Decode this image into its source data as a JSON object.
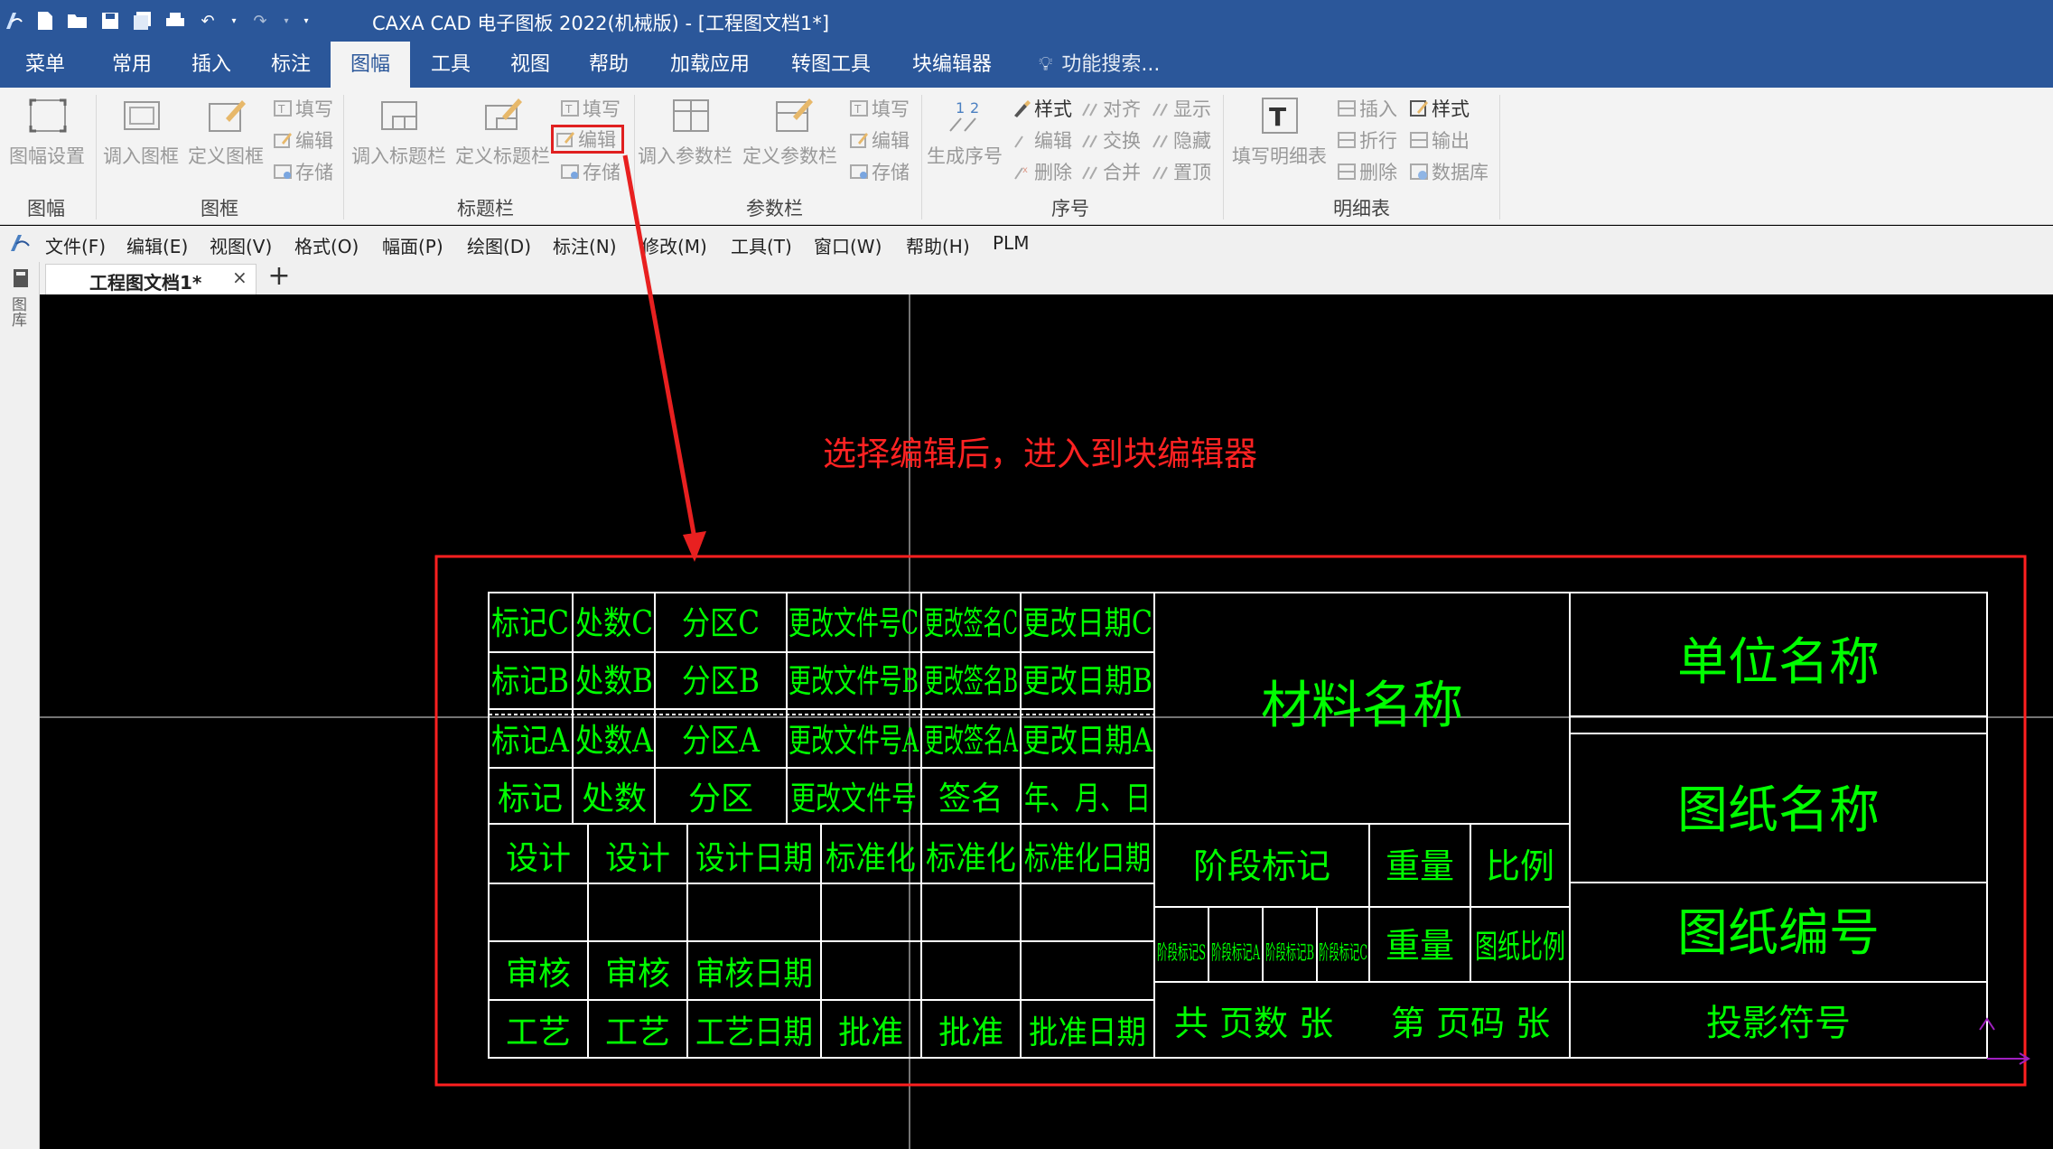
{
  "titlebar": {
    "title": "CAXA CAD 电子图板 2022(机械版) - [工程图文档1*]"
  },
  "ribbon_tabs": [
    "菜单",
    "常用",
    "插入",
    "标注",
    "图幅",
    "工具",
    "视图",
    "帮助",
    "加载应用",
    "转图工具",
    "块编辑器"
  ],
  "ribbon_active_tab": "图幅",
  "search_placeholder": "功能搜索...",
  "ribbon": {
    "groups": {
      "sheet": "图幅",
      "frame": "图框",
      "titleblock": "标题栏",
      "param": "参数栏",
      "seq": "序号",
      "bom": "明细表"
    },
    "sheet_setup": "图幅设置",
    "frame_load": "调入图框",
    "frame_define": "定义图框",
    "frame_fill": "填写",
    "frame_edit": "编辑",
    "frame_save": "存储",
    "tb_load": "调入标题栏",
    "tb_define": "定义标题栏",
    "tb_fill": "填写",
    "tb_edit": "编辑",
    "tb_save": "存储",
    "pm_load": "调入参数栏",
    "pm_define": "定义参数栏",
    "pm_fill": "填写",
    "pm_edit": "编辑",
    "pm_save": "存储",
    "seq_gen": "生成序号",
    "seq_style": "样式",
    "seq_align": "对齐",
    "seq_show": "显示",
    "seq_edit": "编辑",
    "seq_swap": "交换",
    "seq_hide": "隐藏",
    "seq_delete": "删除",
    "seq_merge": "合并",
    "seq_top": "置顶",
    "bom_fill": "填写明细表",
    "bom_insert": "插入",
    "bom_style": "样式",
    "bom_fold": "折行",
    "bom_output": "输出",
    "bom_delete": "删除",
    "bom_db": "数据库"
  },
  "menubar": [
    "文件(F)",
    "编辑(E)",
    "视图(V)",
    "格式(O)",
    "幅面(P)",
    "绘图(D)",
    "标注(N)",
    "修改(M)",
    "工具(T)",
    "窗口(W)",
    "帮助(H)",
    "PLM"
  ],
  "doc_tab": {
    "label": "工程图文档1*",
    "close": "×",
    "add": "+"
  },
  "side_panel_label": "图库",
  "annotation": "选择编辑后，进入到块编辑器",
  "titleblock": {
    "rows_change": [
      [
        "标记C",
        "处数C",
        "分区C",
        "更改文件号C",
        "更改签名C",
        "更改日期C"
      ],
      [
        "标记B",
        "处数B",
        "分区B",
        "更改文件号B",
        "更改签名B",
        "更改日期B"
      ],
      [
        "标记A",
        "处数A",
        "分区A",
        "更改文件号A",
        "更改签名A",
        "更改日期A"
      ],
      [
        "标记",
        "处数",
        "分区",
        "更改文件号",
        "签名",
        "年、月、日"
      ]
    ],
    "row_design": [
      "设计",
      "设计",
      "设计日期",
      "标准化",
      "标准化",
      "标准化日期"
    ],
    "row_review": [
      "审核",
      "审核",
      "审核日期"
    ],
    "row_process": [
      "工艺",
      "工艺",
      "工艺日期",
      "批准",
      "批准",
      "批准日期"
    ],
    "material": "材料名称",
    "stage_mark": "阶段标记",
    "weight": "重量",
    "scale": "比例",
    "stage_vals": [
      "阶段标记S",
      "阶段标记A",
      "阶段标记B",
      "阶段标记C"
    ],
    "weight_val": "重量",
    "scale_val": "图纸比例",
    "pages": "共 页数 张",
    "page_no": "第 页码 张",
    "unit_name": "单位名称",
    "drawing_name": "图纸名称",
    "drawing_no": "图纸编号",
    "projection": "投影符号"
  }
}
